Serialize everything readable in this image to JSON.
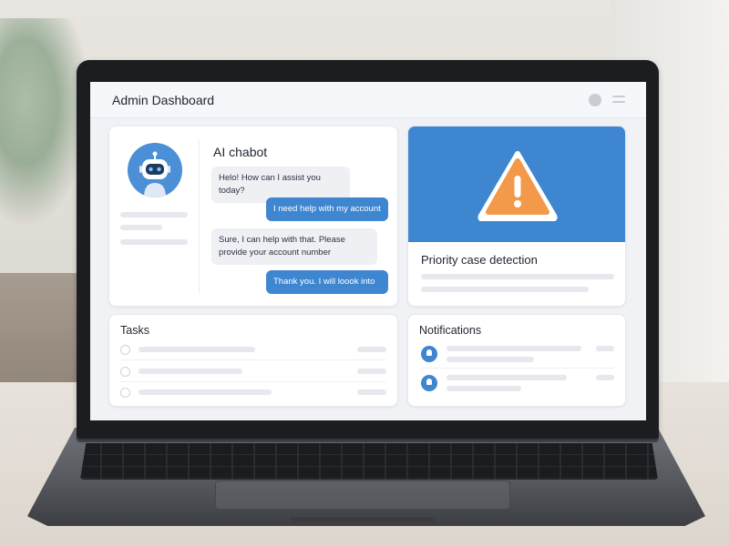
{
  "header": {
    "title": "Admin Dashboard"
  },
  "chat": {
    "title": "AI chabot",
    "messages": [
      {
        "from": "bot",
        "text": "Helo! How can I assist you today?"
      },
      {
        "from": "user",
        "text": "I need help with my account"
      },
      {
        "from": "bot",
        "text": "Sure, I can help with that. Please provide your account number"
      },
      {
        "from": "user",
        "text": "Thank you. I will loook into"
      }
    ]
  },
  "priority": {
    "title": "Priority case detection",
    "icon": "warning-icon"
  },
  "tasks": {
    "title": "Tasks"
  },
  "notifications": {
    "title": "Notifications"
  },
  "colors": {
    "accent": "#3f86d0",
    "warning": "#f2994a",
    "background": "#f1f2f6"
  }
}
